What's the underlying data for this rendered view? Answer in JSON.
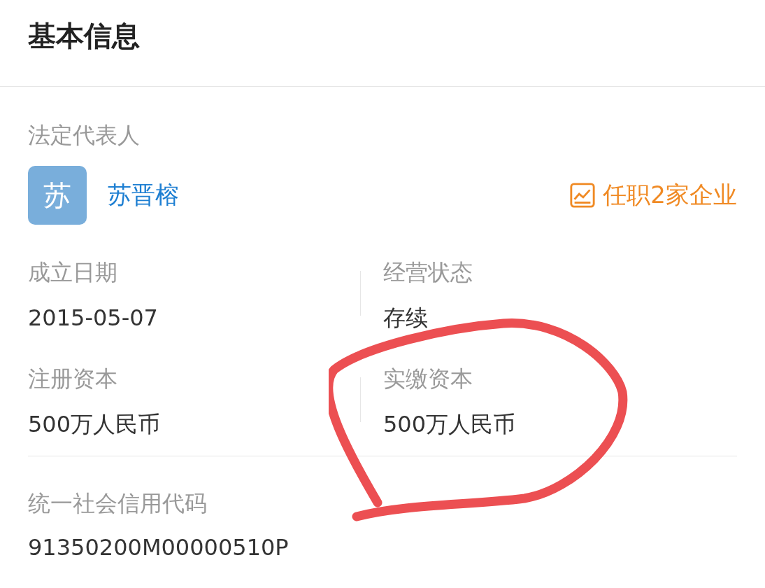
{
  "title": "基本信息",
  "legal_representative": {
    "label": "法定代表人",
    "avatar": "苏",
    "name": "苏晋榕",
    "positions": "任职2家企业"
  },
  "fields": [
    {
      "label": "成立日期",
      "value": "2015-05-07"
    },
    {
      "label": "经营状态",
      "value": "存续"
    },
    {
      "label": "注册资本",
      "value": "500万人民币"
    },
    {
      "label": "实缴资本",
      "value": "500万人民币"
    }
  ],
  "credit_code": {
    "label": "统一社会信用代码",
    "value": "91350200M00000510P"
  }
}
